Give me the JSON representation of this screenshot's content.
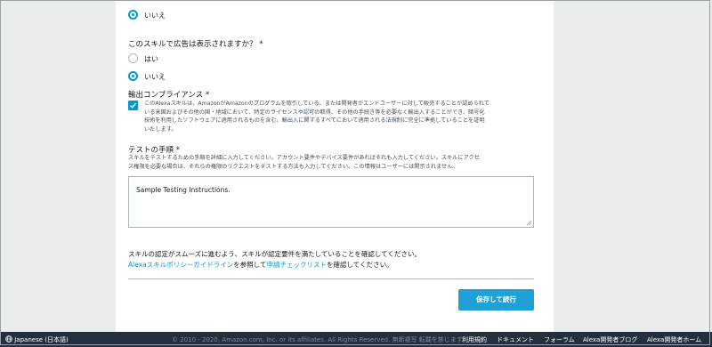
{
  "ads_section": {
    "top_option_label": "いいえ",
    "question": "このスキルで広告は表示されますか？ *",
    "options": [
      "はい",
      "いいえ"
    ]
  },
  "export": {
    "title": "輸出コンプライアンス *",
    "lines": [
      "このAlexaスキルは、AmazonがAmazonのプログラムを取引している、または開発者がエンドユーザーに対して販売することが認められて",
      "いる米国およびその他の国・地域において、特定のライセンスや認可の取得、その他の手続き等を必要なく輸出入することができ、暗号化",
      "技術を利用したソフトウェアに適用されるものを含む、輸出入に関するすべてにおいて適用される法規制に完全に準拠していることを証明",
      "いたします。"
    ]
  },
  "testing": {
    "title": "テストの手順 *",
    "desc_lines": [
      "スキルをテストするための手順を詳細に入力してください。アカウント要件やデバイス要件があればそれも入力してください。スキルにアクセ",
      "ス権限を必要な場合は、それらの権限のリクエストをテストする方法も入力してください。この情報はユーザーには開示されません。"
    ],
    "value": "Sample Testing Instructions."
  },
  "certification": {
    "line1": "スキルの認定がスムーズに進むよう、スキルが認定要件を満たしていることを確認してください。",
    "link1": "Alexaスキルポリシーガイドライン",
    "mid": "を参照して",
    "link2": "申請チェックリスト",
    "end": "を確認してください。"
  },
  "save_button": "保存して続行",
  "footer": {
    "language": "Japanese (日本語)",
    "copyright": "© 2010 - 2020, Amazon.com, Inc. or its affiliates. All Rights Reserved. 無断複写 転載を禁じます",
    "links": [
      "利用規約",
      "ドキュメント",
      "フォーラム",
      "Alexa開発者ブログ",
      "Alexa開発者ホーム"
    ]
  },
  "colors": {
    "accent": "#0099cc",
    "button": "#1fa0d6",
    "footer_bg": "#232f3e",
    "page_bg": "#eaeded"
  }
}
